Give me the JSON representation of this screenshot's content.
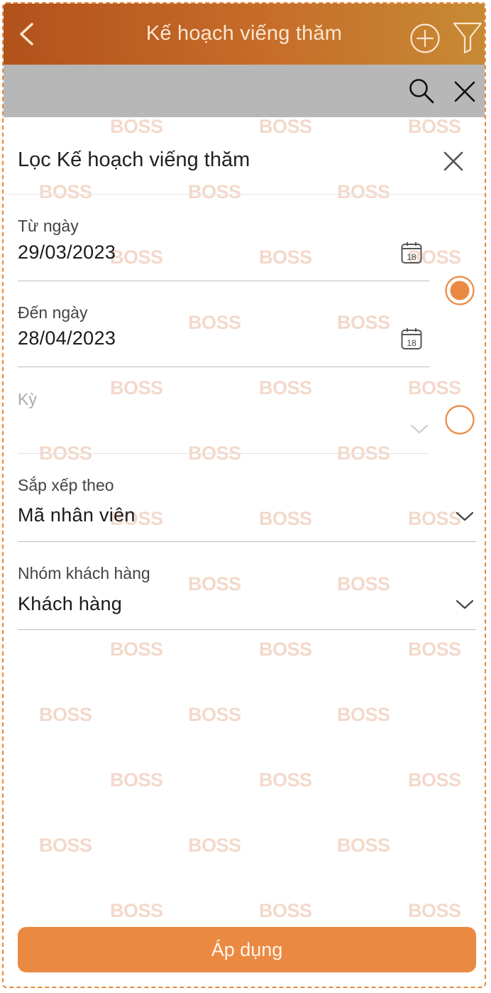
{
  "header": {
    "title": "Kế hoạch viếng thăm"
  },
  "watermark_text": "BOSS",
  "filter_sheet": {
    "title": "Lọc Kế hoạch viếng thăm",
    "from_date": {
      "label": "Từ ngày",
      "value": "29/03/2023",
      "calendar_day": "18"
    },
    "to_date": {
      "label": "Đến ngày",
      "value": "28/04/2023",
      "calendar_day": "18"
    },
    "period": {
      "label": "Kỳ",
      "value": ""
    },
    "sort_by": {
      "label": "Sắp xếp theo",
      "value": "Mã nhân viên"
    },
    "customer_group": {
      "label": "Nhóm khách hàng",
      "value": "Khách hàng"
    },
    "mode_options": [
      {
        "name": "date-range",
        "selected": true
      },
      {
        "name": "period",
        "selected": false
      }
    ],
    "apply_label": "Áp dụng"
  },
  "colors": {
    "accent": "#ea8a42",
    "header_start": "#b2521c",
    "header_end": "#c78a34",
    "search_bar": "#b7b7b7"
  }
}
